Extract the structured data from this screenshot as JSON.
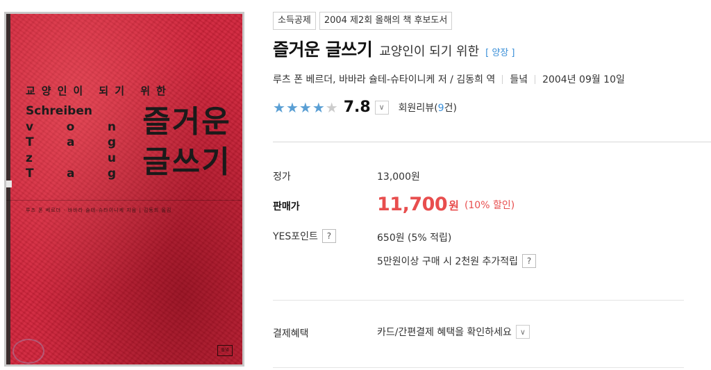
{
  "cover": {
    "subtitle": "교양인이 되기 위한",
    "latin_lines": [
      [
        "Schreiben"
      ],
      [
        "v",
        "o",
        "n"
      ],
      [
        "T",
        "a",
        "g"
      ],
      [
        "z",
        "u"
      ],
      [
        "T",
        "a",
        "g"
      ]
    ],
    "title_line1": "즐거운",
    "title_line2": "글쓰기",
    "authors_line": "루츠 폰 베르더 · 바바라 슐테-슈타이니케 지음 | 김동희 옮김",
    "logo_text": "들녘",
    "background_color": "#d0233a"
  },
  "badges": [
    "소득공제",
    "2004 제2회 올해의 책 후보도서"
  ],
  "title": "즐거운 글쓰기",
  "subtitle": "교양인이 되기 위한",
  "binding": "[ 양장 ]",
  "meta": {
    "authors": "루츠 폰 베르더, 바바라 슐테-슈타이니케 저 / 김동희 역",
    "publisher": "들녘",
    "date": "2004년 09월 10일"
  },
  "rating": {
    "stars_filled": 4,
    "stars_total": 5,
    "score": "7.8",
    "review_label": "회원리뷰(",
    "review_count": "9",
    "review_suffix": "건)"
  },
  "price": {
    "list_label": "정가",
    "list_value": "13,000원",
    "sale_label": "판매가",
    "sale_value": "11,700",
    "sale_unit": "원",
    "discount": "(10% 할인)"
  },
  "points": {
    "label": "YES포인트",
    "help": "?",
    "value": "650원 (5% 적립)",
    "extra": "5만원이상 구매 시 2천원 추가적립",
    "extra_help": "?"
  },
  "payment": {
    "label": "결제혜택",
    "value": "카드/간편결제 혜택을 확인하세요"
  },
  "colors": {
    "accent_blue": "#3a8fd8",
    "sale_red": "#e84e4e",
    "star_blue": "#5a9fd4"
  },
  "icons": {
    "dropdown": "chevron-down-icon",
    "help": "question-icon",
    "star": "star-icon"
  }
}
